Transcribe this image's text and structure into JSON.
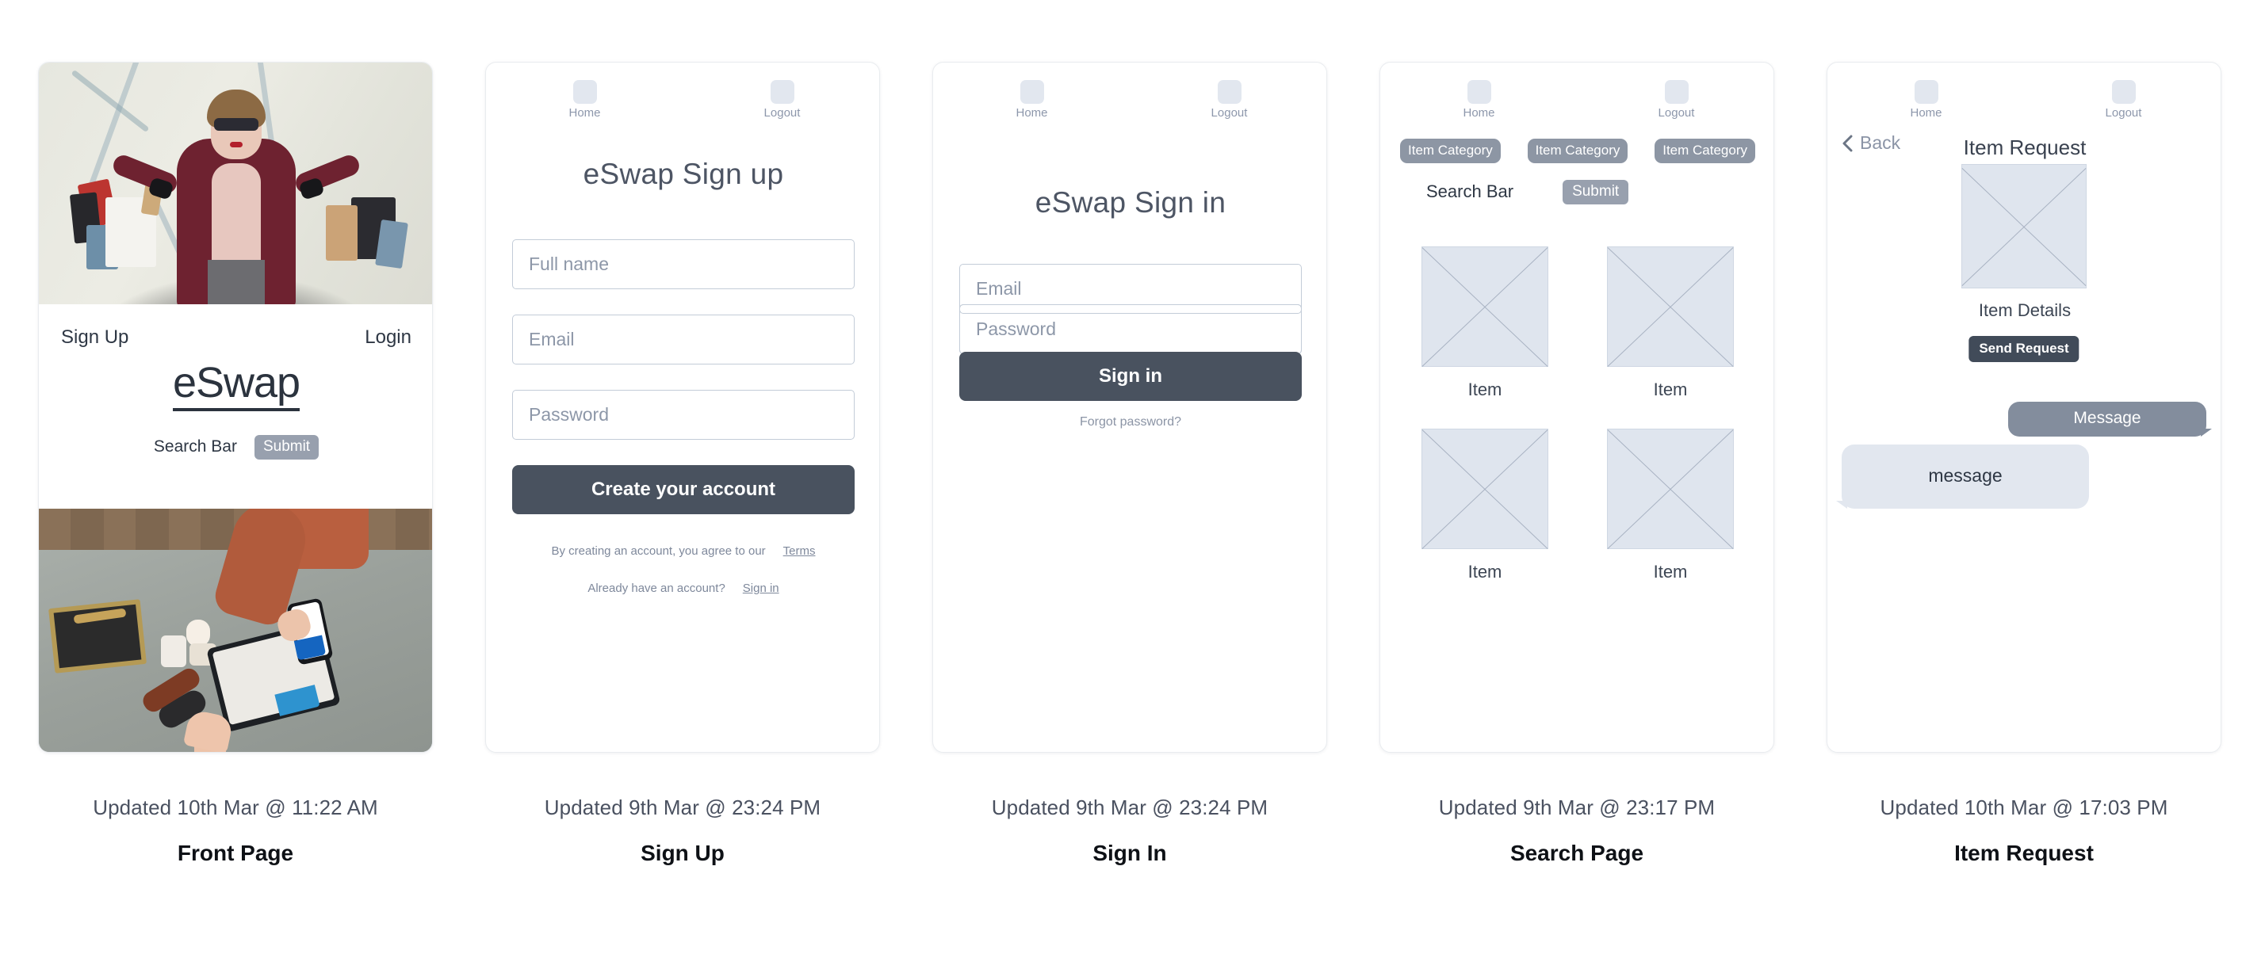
{
  "cards": [
    {
      "key": "front_page",
      "caption_updated": "Updated 10th Mar @ 11:22 AM",
      "caption_title": "Front Page",
      "nav_left": "Sign Up",
      "nav_right": "Login",
      "logo": "eSwap",
      "search_label": "Search Bar",
      "submit_label": "Submit"
    },
    {
      "key": "sign_up",
      "caption_updated": "Updated 9th Mar @ 23:24 PM",
      "caption_title": "Sign Up",
      "nav_home": "Home",
      "nav_logout": "Logout",
      "title": "eSwap Sign up",
      "field_fullname": "Full name",
      "field_email": "Email",
      "field_password": "Password",
      "cta": "Create your account",
      "terms_text": "By creating an account, you agree to our",
      "terms_link": "Terms",
      "already_text": "Already have an account?",
      "already_link": "Sign in"
    },
    {
      "key": "sign_in",
      "caption_updated": "Updated 9th Mar @ 23:24 PM",
      "caption_title": "Sign In",
      "nav_home": "Home",
      "nav_logout": "Logout",
      "title": "eSwap Sign in",
      "field_email": "Email",
      "field_password": "Password",
      "cta": "Sign in",
      "forgot_link": "Forgot password?"
    },
    {
      "key": "search_page",
      "caption_updated": "Updated 9th Mar @ 23:17 PM",
      "caption_title": "Search Page",
      "nav_home": "Home",
      "nav_logout": "Logout",
      "categories": [
        "Item Category",
        "Item Category",
        "Item Category"
      ],
      "search_label": "Search Bar",
      "submit_label": "Submit",
      "items": [
        "Item",
        "Item",
        "Item",
        "Item"
      ]
    },
    {
      "key": "item_request",
      "caption_updated": "Updated 10th Mar @ 17:03 PM",
      "caption_title": "Item Request",
      "nav_home": "Home",
      "nav_logout": "Logout",
      "back_label": "Back",
      "title": "Item Request",
      "details_label": "Item Details",
      "send_label": "Send Request",
      "message_out": "Message",
      "message_in": "message"
    }
  ],
  "colors": {
    "dark_button": "#49525f",
    "chip_gray": "#8d96a4",
    "submit_gray": "#98a0ae",
    "placeholder_fill": "#dfe5ee",
    "nav_icon": "#e2e7ef",
    "bubble_out": "#838d9d",
    "bubble_in": "#e2e7ef",
    "card_border": "#e9ecef"
  }
}
